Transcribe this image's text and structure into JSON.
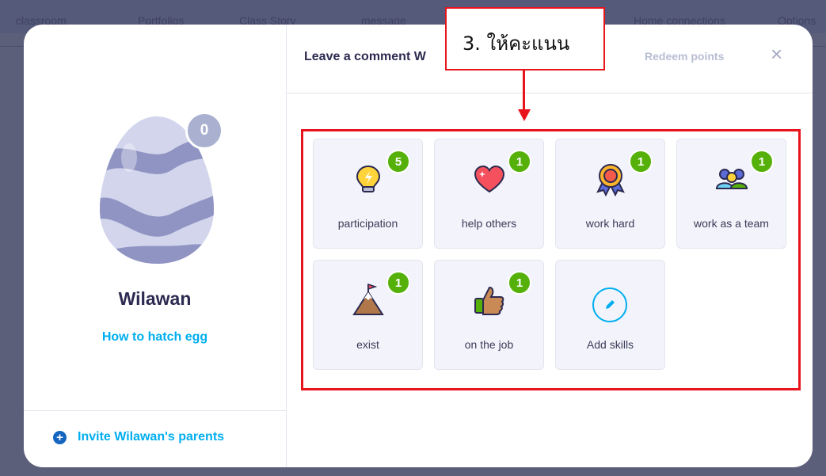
{
  "background_nav": {
    "items": [
      "classroom",
      "Portfolios",
      "Class Story",
      "message",
      "Home connections",
      "Options"
    ]
  },
  "left_panel": {
    "egg_points": "0",
    "student_name": "Wilawan",
    "hatch_link": "How to hatch egg",
    "invite_label": "Invite Wilawan's parents"
  },
  "header": {
    "title": "Leave a comment W",
    "redeem": "Redeem points",
    "close": "×"
  },
  "skills": [
    {
      "label": "participation",
      "count": "5",
      "icon": "lightbulb-icon"
    },
    {
      "label": "help others",
      "count": "1",
      "icon": "heart-icon"
    },
    {
      "label": "work hard",
      "count": "1",
      "icon": "medal-icon"
    },
    {
      "label": "work as a team",
      "count": "1",
      "icon": "team-icon"
    },
    {
      "label": "exist",
      "count": "1",
      "icon": "mountain-flag-icon"
    },
    {
      "label": "on the job",
      "count": "1",
      "icon": "thumbs-up-icon"
    }
  ],
  "add_skill": {
    "label": "Add skills",
    "icon": "pencil-icon"
  },
  "annotation": {
    "callout_text": "3. ให้คะแนน",
    "color": "#e8141b"
  },
  "colors": {
    "accent": "#00aeef",
    "badge_green": "#55b10a",
    "egg_badge": "#aab0d0"
  }
}
